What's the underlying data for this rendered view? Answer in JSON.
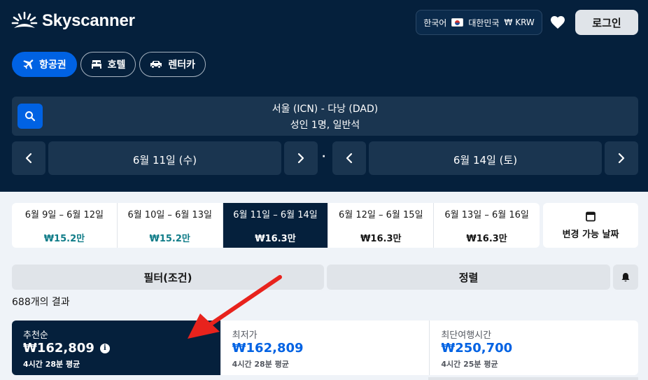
{
  "header": {
    "brand": "Skyscanner",
    "locale": {
      "language": "한국어",
      "country": "대한민국",
      "currency": "₩ KRW"
    },
    "login_label": "로그인",
    "tabs": [
      {
        "label": "항공권",
        "icon": "plane-icon",
        "active": true
      },
      {
        "label": "호텔",
        "icon": "bed-icon",
        "active": false
      },
      {
        "label": "렌터카",
        "icon": "car-icon",
        "active": false
      }
    ]
  },
  "search": {
    "route": "서울 (ICN) - 다낭 (DAD)",
    "details": "성인 1명, 일반석",
    "depart_date": "6월 11일 (수)",
    "return_date": "6월 14일 (토)",
    "separator": "·"
  },
  "date_options": [
    {
      "range": "6월 9일 – 6월 12일",
      "price": "₩15.2만"
    },
    {
      "range": "6월 10일 – 6월 13일",
      "price": "₩15.2만"
    },
    {
      "range": "6월 11일 – 6월 14일",
      "price": "₩16.3만"
    },
    {
      "range": "6월 12일 – 6월 15일",
      "price": "₩16.3만"
    },
    {
      "range": "6월 13일 – 6월 16일",
      "price": "₩16.3만"
    }
  ],
  "flexible_dates_label": "변경 가능 날짜",
  "controls": {
    "filter_label": "필터(조건)",
    "sort_label": "정렬"
  },
  "results_count": "688개의 결과",
  "sort_options": [
    {
      "title": "추천순",
      "price": "₩162,809",
      "subtitle": "4시간 28분 평균",
      "active": true
    },
    {
      "title": "최저가",
      "price": "₩162,809",
      "subtitle": "4시간 28분 평균",
      "active": false
    },
    {
      "title": "최단여행시간",
      "price": "₩250,700",
      "subtitle": "4시간 25분 평균",
      "active": false
    }
  ],
  "colors": {
    "header_bg": "#05203c",
    "accent_blue": "#0062e3",
    "teal_price": "#0f7c88",
    "annotation_red": "#e8231d"
  }
}
